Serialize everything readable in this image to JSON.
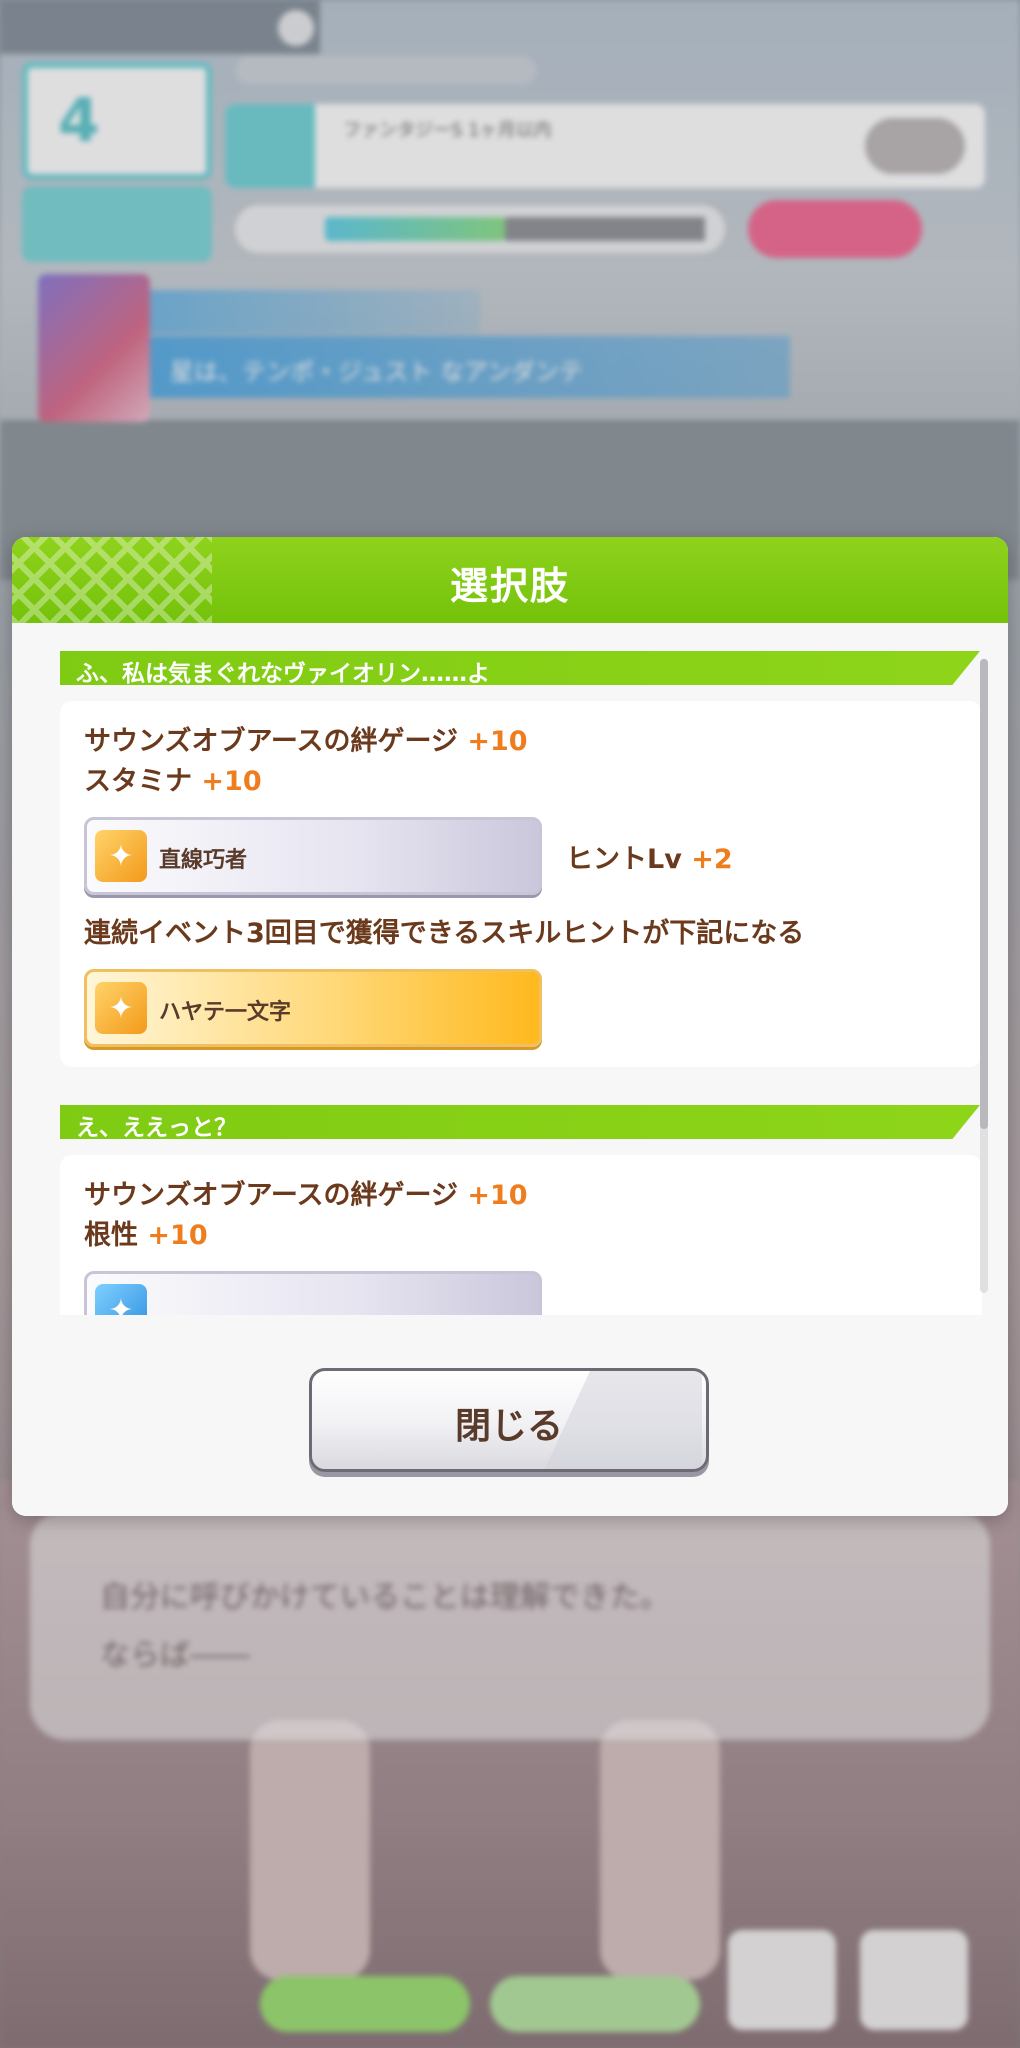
{
  "background": {
    "hud": {
      "turn_number": "4",
      "goal_text": "ファンタジーS 1ヶ月以内",
      "event_title": "星は、テンポ・ジュスト なアンダンテ"
    },
    "dialog_lines": [
      "自分に呼びかけていることは理解できた。",
      "ならば――"
    ]
  },
  "modal": {
    "title": "選択肢",
    "header_color": "#7cc512",
    "choices": [
      {
        "label": "ふ、私は気まぐれなヴァイオリン……よ",
        "rows": [
          {
            "text": "サウンズオブアースの絆ゲージ",
            "plus": "+10"
          },
          {
            "text": "スタミナ",
            "plus": "+10"
          }
        ],
        "skill_hint": {
          "skill_name": "直線巧者",
          "hint_label": "ヒントLv",
          "hint_plus": "+2"
        },
        "chain_note": "連続イベント3回目で獲得できるスキルヒントが下記になる",
        "chain_skill": {
          "skill_name": "ハヤテ一文字"
        }
      },
      {
        "label": "え、ええっと？",
        "rows": [
          {
            "text": "サウンズオブアースの絆ゲージ",
            "plus": "+10"
          },
          {
            "text": "根性",
            "plus": "+10"
          }
        ]
      }
    ],
    "close_label": "閉じる",
    "accent_text_color": "#6b3a1c",
    "plus_color": "#ef7d1e"
  }
}
